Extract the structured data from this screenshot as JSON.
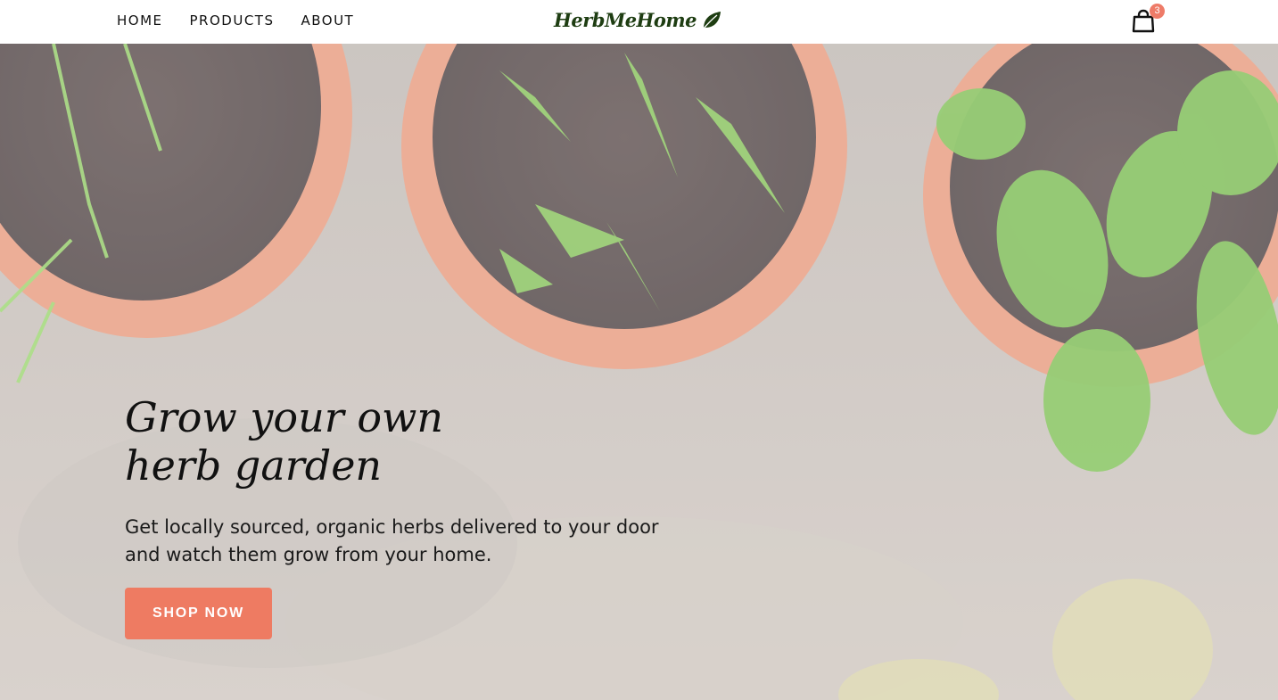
{
  "nav": {
    "links": [
      {
        "label": "HOME"
      },
      {
        "label": "PRODUCTS"
      },
      {
        "label": "ABOUT"
      }
    ],
    "logo_text": "HerbMeHome",
    "cart": {
      "icon": "shopping-bag-icon",
      "count": "3"
    }
  },
  "hero": {
    "title": "Grow your own herb garden",
    "subtitle": "Get locally sourced, organic herbs delivered to your door and watch them grow from your home.",
    "cta_label": "SHOP NOW"
  },
  "colors": {
    "accent": "#ee7b62",
    "logo_green": "#1e3d12",
    "badge": "#ee7b68"
  }
}
